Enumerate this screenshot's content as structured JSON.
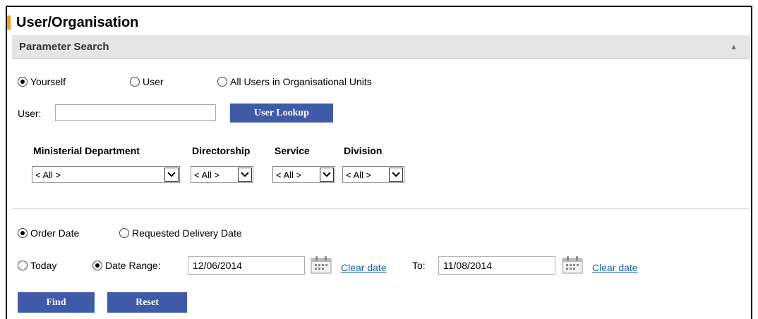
{
  "page": {
    "title": "User/Organisation"
  },
  "section": {
    "title": "Parameter Search"
  },
  "scope": {
    "options": [
      {
        "label": "Yourself",
        "checked": true
      },
      {
        "label": "User",
        "checked": false
      },
      {
        "label": "All Users in Organisational Units",
        "checked": false
      }
    ]
  },
  "user": {
    "label": "User:",
    "value": "",
    "lookup_label": "User Lookup"
  },
  "org": {
    "headers": [
      "Ministerial Department",
      "Directorship",
      "Service",
      "Division"
    ],
    "values": [
      "< All >",
      "< All >",
      "< All >",
      "< All >"
    ]
  },
  "date_type": {
    "options": [
      {
        "label": "Order Date",
        "checked": true
      },
      {
        "label": "Requested Delivery Date",
        "checked": false
      }
    ]
  },
  "date": {
    "today_label": "Today",
    "range_label": "Date Range:",
    "from_value": "12/06/2014",
    "to_label": "To:",
    "to_value": "11/08/2014",
    "clear_label": "Clear date"
  },
  "actions": {
    "find": "Find",
    "reset": "Reset"
  },
  "colors": {
    "accent": "#f0a018",
    "button": "#3e5aa8",
    "header_bg": "#e5e5e5",
    "link": "#1a5fb4"
  }
}
